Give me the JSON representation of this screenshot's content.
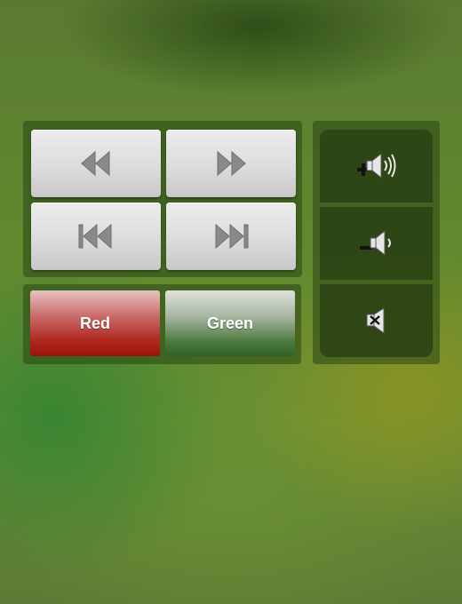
{
  "transport": {
    "buttons": [
      {
        "name": "rewind",
        "icon": "rewind-icon"
      },
      {
        "name": "fast-forward",
        "icon": "fast-forward-icon"
      },
      {
        "name": "skip-previous",
        "icon": "skip-previous-icon"
      },
      {
        "name": "skip-next",
        "icon": "skip-next-icon"
      }
    ]
  },
  "color_buttons": {
    "red_label": "Red",
    "green_label": "Green"
  },
  "volume": {
    "buttons": [
      {
        "name": "volume-up",
        "icon": "volume-up-icon"
      },
      {
        "name": "volume-down",
        "icon": "volume-down-icon"
      },
      {
        "name": "mute",
        "icon": "mute-icon"
      }
    ]
  },
  "colors": {
    "red": "#b02a22",
    "green": "#4e7a40",
    "button_gray": "#dcdcdc",
    "icon_gray": "#8a8a8a"
  }
}
